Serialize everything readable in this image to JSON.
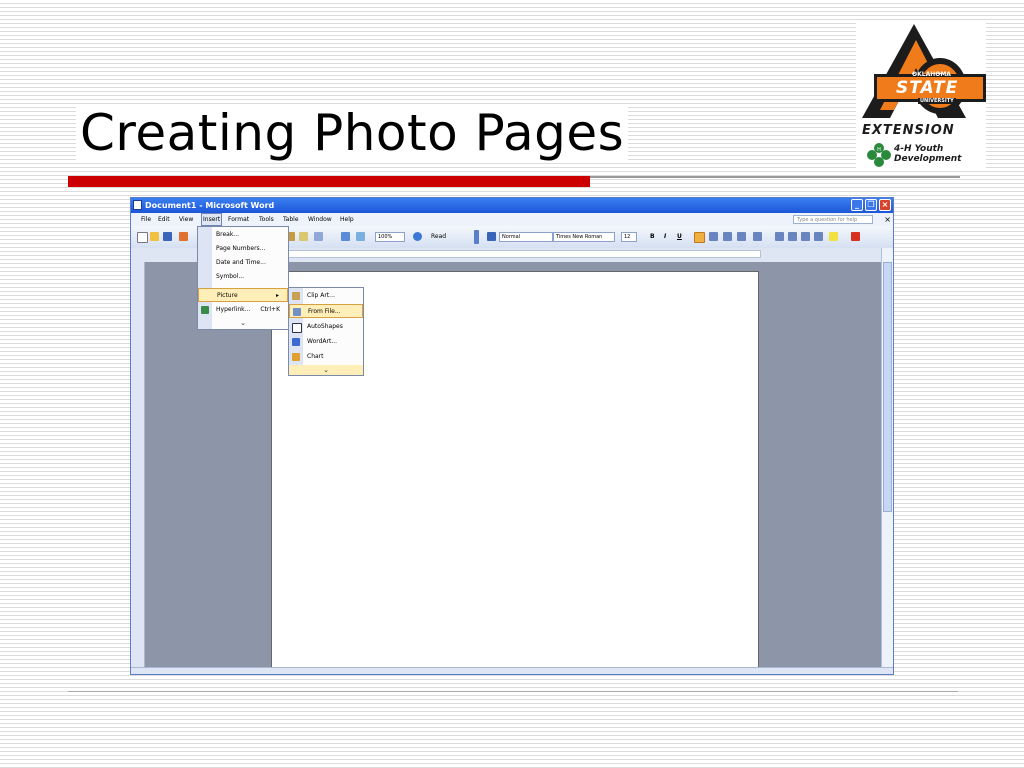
{
  "slide": {
    "title": "Creating Photo Pages"
  },
  "logo": {
    "wordmark_line1": "OKLAHOMA",
    "wordmark_line2": "STATE",
    "wordmark_line3": "UNIVERSITY",
    "extension": "EXTENSION",
    "youth_line1": "4-H Youth",
    "youth_line2": "Development",
    "colors": {
      "orange": "#f07b1a",
      "black": "#1c1c1c",
      "green": "#2a8a3c"
    }
  },
  "word": {
    "window_title": "Document1 - Microsoft Word",
    "menu": [
      "File",
      "Edit",
      "View",
      "Insert",
      "Format",
      "Tools",
      "Table",
      "Window",
      "Help"
    ],
    "help_placeholder": "Type a question for help",
    "toolbar": {
      "zoom": "100%",
      "read": "Read",
      "style": "Normal",
      "font": "Times New Roman",
      "size": "12",
      "bold": "B",
      "italic": "I",
      "underline": "U"
    },
    "insert_menu": [
      {
        "label": "Break...",
        "shortcut": ""
      },
      {
        "label": "Page Numbers...",
        "shortcut": ""
      },
      {
        "label": "Date and Time...",
        "shortcut": ""
      },
      {
        "label": "Symbol...",
        "shortcut": ""
      },
      {
        "label": "Picture",
        "shortcut": "▸"
      },
      {
        "label": "Hyperlink...",
        "shortcut": "Ctrl+K"
      }
    ],
    "picture_menu": [
      {
        "label": "Clip Art..."
      },
      {
        "label": "From File..."
      },
      {
        "label": "AutoShapes"
      },
      {
        "label": "WordArt..."
      },
      {
        "label": "Chart"
      }
    ],
    "expand_glyph": "⌄"
  }
}
